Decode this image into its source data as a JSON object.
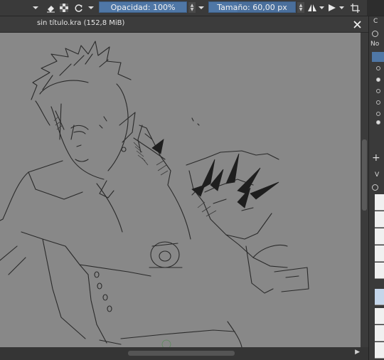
{
  "toolbar": {
    "opacity_label": "Opacidad: 100%",
    "size_label": "Tamaño: 60,00 px"
  },
  "document": {
    "tab_title": "sin título.kra (152,8 MiB)"
  },
  "dockers": {
    "layers_header_fragment": "C",
    "layer_column_label": "No",
    "brushes_header_fragment": "V"
  }
}
